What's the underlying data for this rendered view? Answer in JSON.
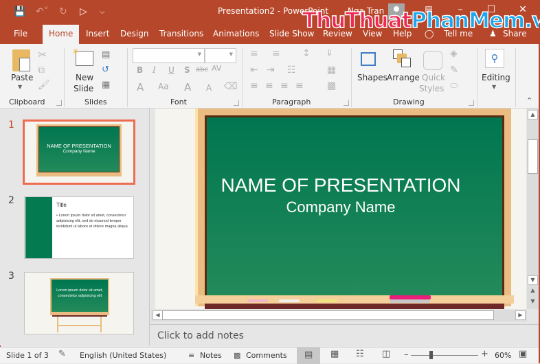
{
  "quick_access": {
    "save_icon": "save-icon",
    "undo_icon": "undo-icon",
    "redo_icon": "redo-icon",
    "present_icon": "start-from-beginning-icon",
    "customize_icon": "customize-quick-access-icon"
  },
  "titlebar": {
    "document_title": "Presentation2  -  PowerPoint",
    "user_name": "Nga Tran",
    "window_controls": [
      "ribbon-display-options",
      "minimize",
      "maximize",
      "close"
    ]
  },
  "watermark": {
    "part1": "ThuThuat",
    "part2": "PhanMem.vn"
  },
  "tabs": [
    {
      "label": "File"
    },
    {
      "label": "Home",
      "active": true
    },
    {
      "label": "Insert"
    },
    {
      "label": "Design"
    },
    {
      "label": "Transitions"
    },
    {
      "label": "Animations"
    },
    {
      "label": "Slide Show"
    },
    {
      "label": "Review"
    },
    {
      "label": "View"
    },
    {
      "label": "Help"
    },
    {
      "label": "Tell me"
    },
    {
      "label": "Share"
    }
  ],
  "ribbon": {
    "clipboard": {
      "label": "Clipboard",
      "paste": "Paste"
    },
    "slides": {
      "label": "Slides",
      "new_slide_line1": "New",
      "new_slide_line2": "Slide"
    },
    "font": {
      "label": "Font",
      "font_name": "",
      "font_size": "",
      "bold": "B",
      "italic": "I",
      "underline": "U",
      "shadow": "S",
      "strikethrough": "abc",
      "spacing": "AV",
      "font_color": "A",
      "change_case": "Aa",
      "grow": "A",
      "shrink": "A"
    },
    "paragraph": {
      "label": "Paragraph"
    },
    "drawing": {
      "label": "Drawing",
      "shapes": "Shapes",
      "arrange": "Arrange",
      "quick_styles_line1": "Quick",
      "quick_styles_line2": "Styles"
    },
    "editing": {
      "label": "Editing"
    }
  },
  "slides": [
    {
      "number": "1",
      "title": "NAME OF PRESENTATION",
      "subtitle": "Company Name",
      "selected": true
    },
    {
      "number": "2",
      "title": "Title",
      "bullet": "Lorem ipsum dolor sit amet, consectetur adipisicing elit, sed do eiusmod tempor incididunt ut labore et dolore magna aliqua."
    },
    {
      "number": "3",
      "body": "Lorem ipsum dolor sit amet, consectetur adipisicing elit"
    }
  ],
  "current_slide": {
    "title": "NAME OF PRESENTATION",
    "subtitle": "Company Name"
  },
  "notes_placeholder": "Click to add notes",
  "status": {
    "slide_counter": "Slide 1 of 3",
    "language": "English (United States)",
    "notes": "Notes",
    "comments": "Comments",
    "zoom": "60%",
    "zoom_fraction": 0.3
  },
  "colors": {
    "accent": "#b7472a",
    "board": "#007650",
    "selection": "#ec6d4f"
  }
}
